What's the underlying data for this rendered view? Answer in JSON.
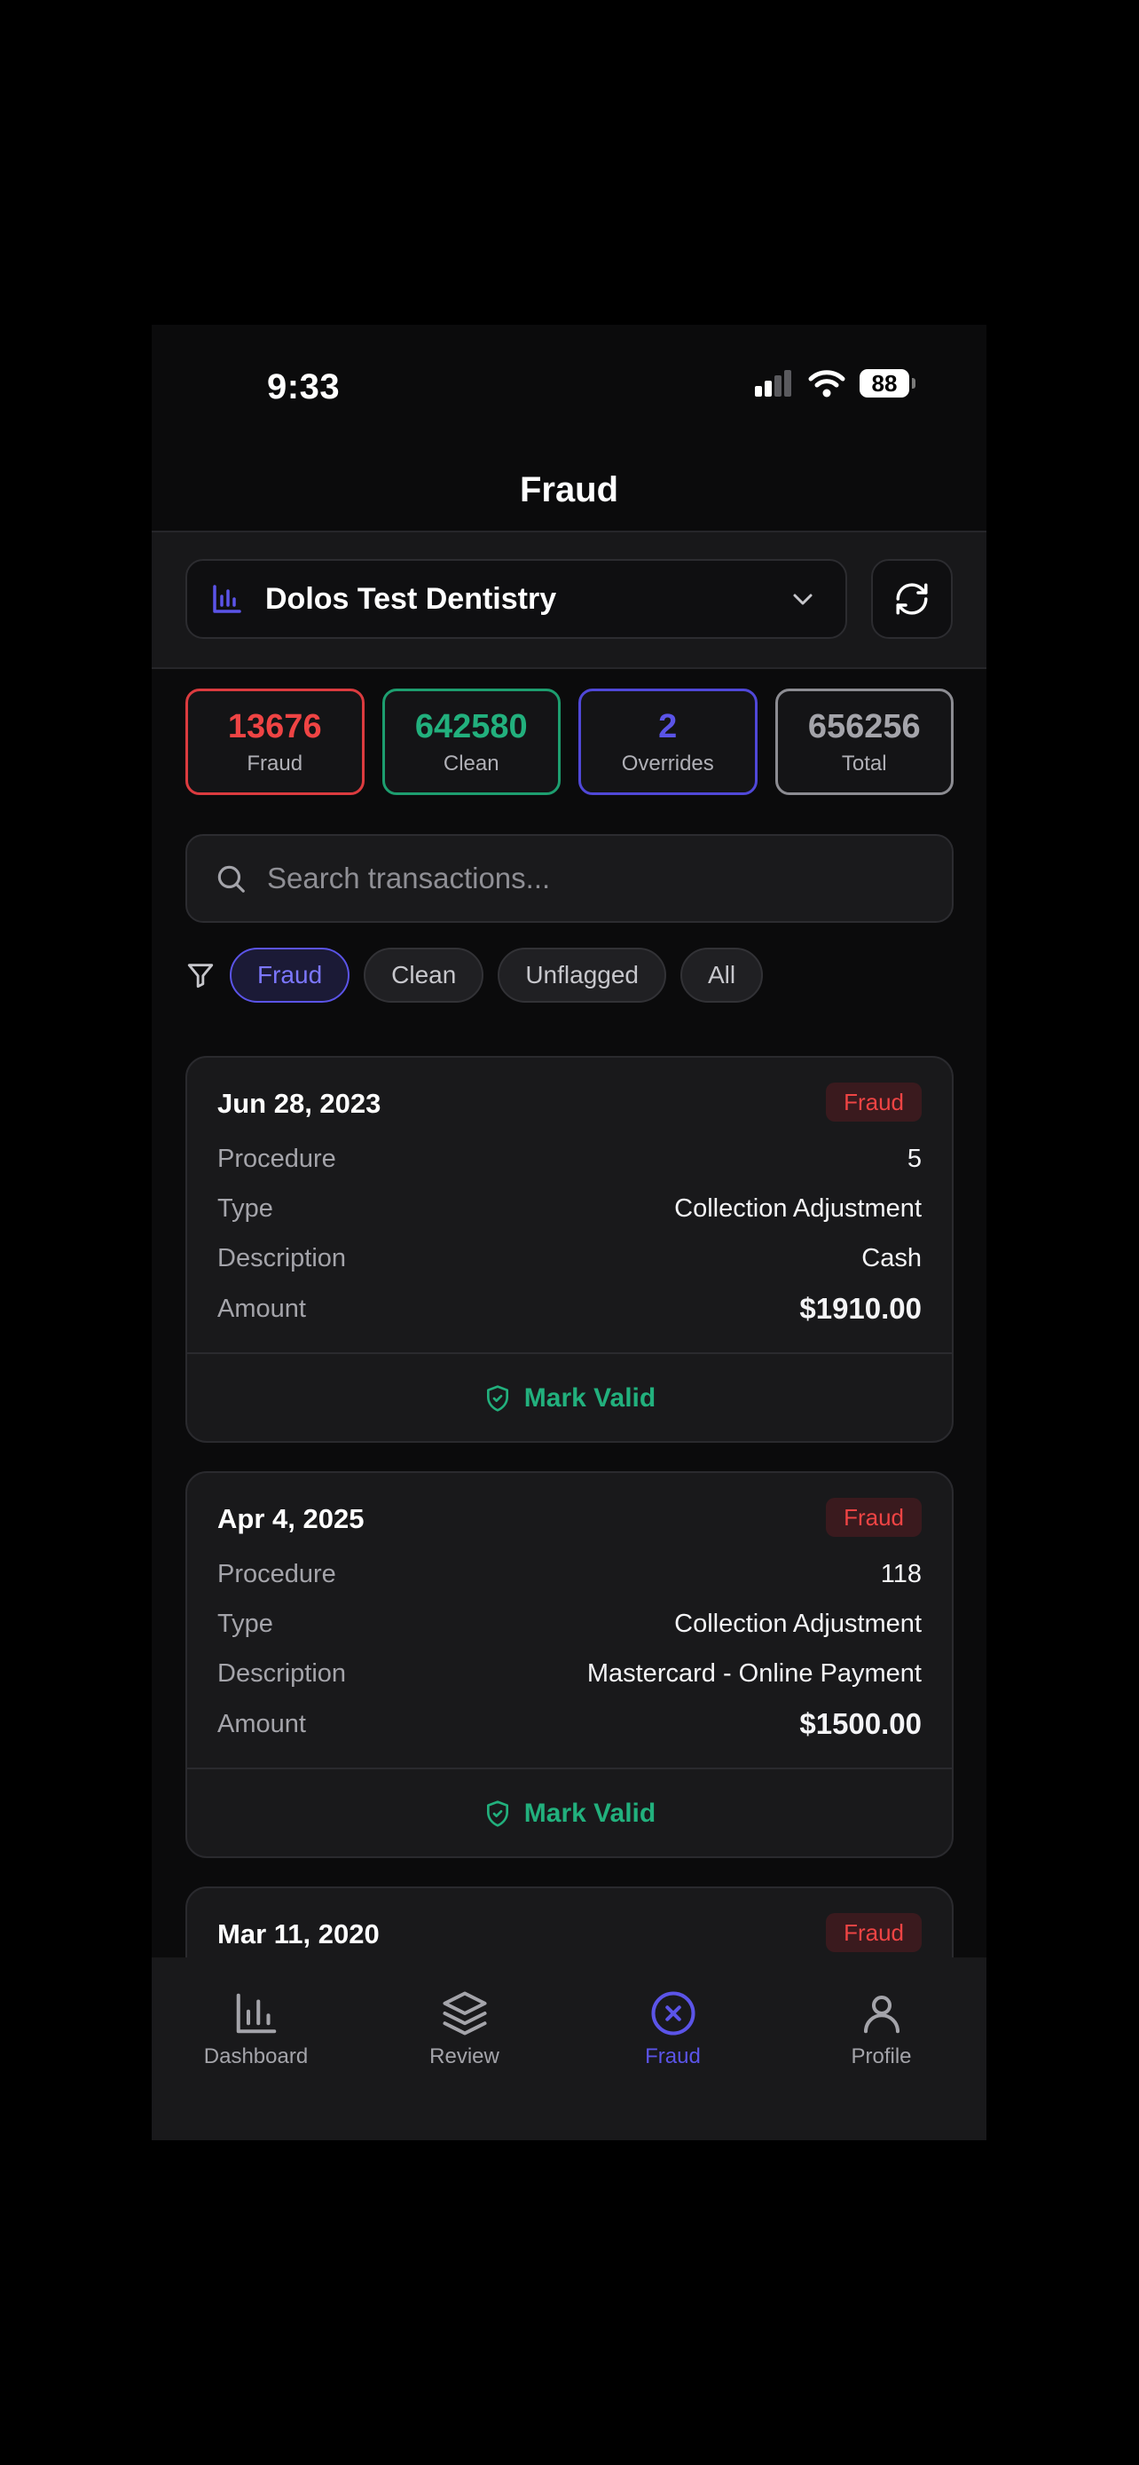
{
  "status_bar": {
    "time": "9:33",
    "battery": "88",
    "icons": [
      "signal-icon",
      "wifi-icon",
      "battery-icon"
    ]
  },
  "header": {
    "title": "Fraud"
  },
  "org_selector": {
    "name": "Dolos Test Dentistry",
    "icon": "bar-chart-icon",
    "dropdown_icon": "chevron-down-icon"
  },
  "refresh": {
    "icon": "refresh-icon"
  },
  "stats": [
    {
      "value": "13676",
      "label": "Fraud",
      "color": "#ef4444"
    },
    {
      "value": "642580",
      "label": "Clean",
      "color": "#22b07d"
    },
    {
      "value": "2",
      "label": "Overrides",
      "color": "#5b54e8"
    },
    {
      "value": "656256",
      "label": "Total",
      "color": "#a4a4aa"
    }
  ],
  "search": {
    "placeholder": "Search transactions..."
  },
  "filters": {
    "icon": "filter-icon",
    "options": [
      "Fraud",
      "Clean",
      "Unflagged",
      "All"
    ],
    "selected": "Fraud"
  },
  "field_labels": {
    "procedure": "Procedure",
    "type": "Type",
    "description": "Description",
    "amount": "Amount"
  },
  "transactions": [
    {
      "date": "Jun 28, 2023",
      "status": "Fraud",
      "procedure": "5",
      "type": "Collection Adjustment",
      "description": "Cash",
      "amount": "$1910.00",
      "action": "Mark Valid"
    },
    {
      "date": "Apr 4, 2025",
      "status": "Fraud",
      "procedure": "118",
      "type": "Collection Adjustment",
      "description": "Mastercard - Online Payment",
      "amount": "$1500.00",
      "action": "Mark Valid"
    },
    {
      "date": "Mar 11, 2020",
      "status": "Fraud"
    }
  ],
  "nav": [
    {
      "label": "Dashboard",
      "icon": "bar-chart-icon"
    },
    {
      "label": "Review",
      "icon": "layers-icon"
    },
    {
      "label": "Fraud",
      "icon": "x-circle-icon",
      "active": true
    },
    {
      "label": "Profile",
      "icon": "user-icon"
    }
  ],
  "colors": {
    "accent": "#5b54e8",
    "fraud": "#ef4444",
    "clean": "#22b07d",
    "background": "#0b0b0c"
  }
}
